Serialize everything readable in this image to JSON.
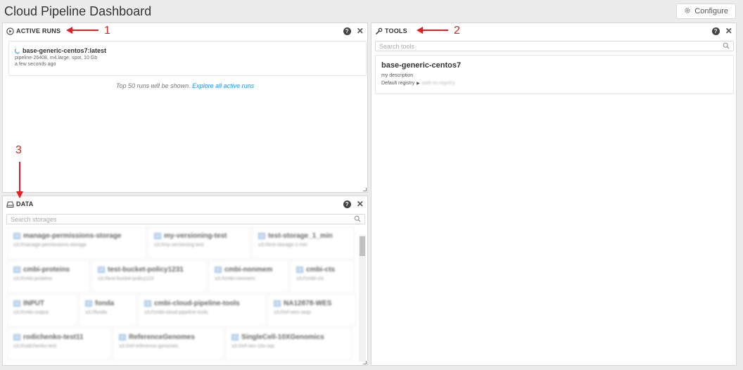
{
  "header": {
    "title": "Cloud Pipeline Dashboard",
    "configure_label": "Configure"
  },
  "annotations": {
    "one": "1",
    "two": "2",
    "three": "3"
  },
  "active_runs": {
    "title": "ACTIVE RUNS",
    "run": {
      "name": "base-generic-centos7:latest",
      "details": "pipeline-26408, m4.large, spot, 10 Gb",
      "time": "a few seconds ago"
    },
    "footer_text": "Top 50 runs will be shown.",
    "footer_link": "Explore all active runs"
  },
  "tools": {
    "title": "TOOLS",
    "search_placeholder": "Search tools",
    "tool": {
      "name": "base-generic-centos7",
      "description": "my description",
      "registry_label": "Default registry",
      "registry_value": "path-to-registry"
    }
  },
  "data": {
    "title": "DATA",
    "search_placeholder": "Search storages",
    "storage_rows": [
      [
        {
          "name": "manage-permissions-storage",
          "path": "s3://manage-permissions-storage"
        },
        {
          "name": "my-versioning-test",
          "path": "s3://my-versioning-test"
        },
        {
          "name": "test-storage_1_min",
          "path": "s3://test-storage-1-min"
        }
      ],
      [
        {
          "name": "cmbi-proteins",
          "path": "s3://cmbi-proteins"
        },
        {
          "name": "test-bucket-policy1231",
          "path": "s3://test-bucket-policy123"
        },
        {
          "name": "cmbi-nonmem",
          "path": "s3://cmbi-nonmem"
        },
        {
          "name": "cmbi-cts",
          "path": "s3://cmbi-cts"
        }
      ],
      [
        {
          "name": "INPUT",
          "path": "s3://cmbi-output"
        },
        {
          "name": "fonda",
          "path": "s3://fonda"
        },
        {
          "name": "cmbi-cloud-pipeline-tools",
          "path": "s3://cmbi-cloud-pipeline-tools"
        },
        {
          "name": "NA12878-WES",
          "path": "s3://ref-wes-seqs"
        }
      ],
      [
        {
          "name": "rodichenko-test11",
          "path": "s3://rodichenko-test"
        },
        {
          "name": "ReferenceGenomes",
          "path": "s3://ref-reference-genomes"
        },
        {
          "name": "SingleCell-10XGenomics",
          "path": "s3://ref-sim-10x-sqc"
        }
      ]
    ]
  },
  "colors": {
    "link": "#1890ff",
    "annotation": "#e02020"
  }
}
